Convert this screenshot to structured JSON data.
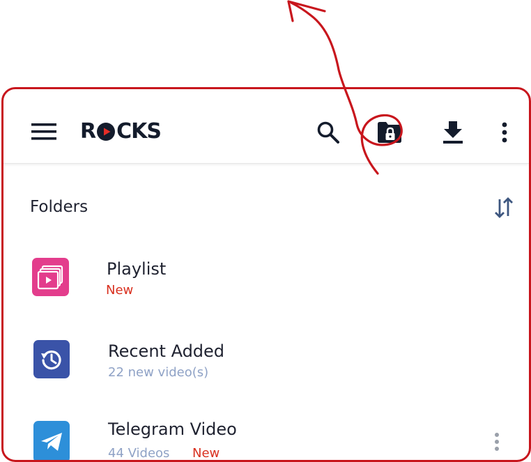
{
  "app": {
    "logo_text_before": "R",
    "logo_text_after": "CKS",
    "logo_accent_color": "#e52d27",
    "logo_text_color": "#141c2c"
  },
  "toolbar": {
    "menu_icon": "hamburger-menu-icon",
    "search_icon": "search-icon",
    "private_folder_icon": "locked-folder-icon",
    "download_icon": "download-icon",
    "more_icon": "more-vertical-icon"
  },
  "folders": {
    "title": "Folders",
    "sort_icon": "sort-arrows-icon",
    "items": [
      {
        "name": "Playlist",
        "subtitle": "New",
        "subtitle_color": "#d9301f",
        "icon": "playlist-icon",
        "icon_color": "#e33d8c"
      },
      {
        "name": "Recent Added",
        "subtitle": "22 new video(s)",
        "subtitle_color": "#8fa2c6",
        "icon": "history-icon",
        "icon_color": "#3a53a8"
      },
      {
        "name": "Telegram Video",
        "subtitle": "44 Videos",
        "badge": "New",
        "badge_color": "#d9301f",
        "icon": "telegram-icon",
        "icon_color": "#2d8fd9"
      }
    ]
  },
  "annotation": {
    "color": "#c8161d",
    "frame_color": "#c8161d"
  }
}
